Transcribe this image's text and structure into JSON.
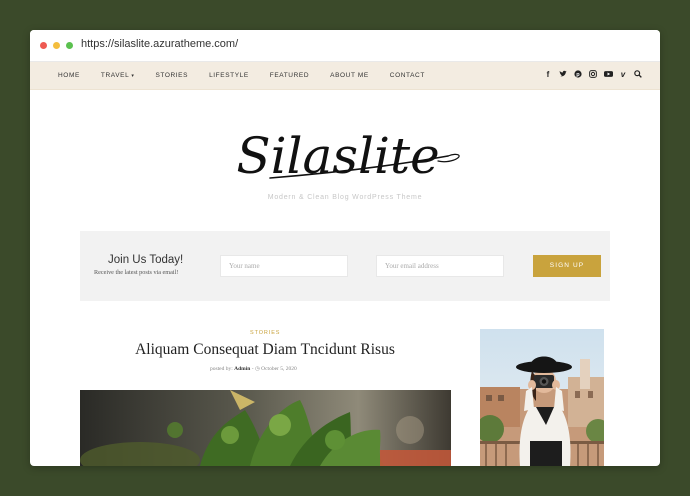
{
  "browser": {
    "url": "https://silaslite.azuratheme.com/"
  },
  "nav": {
    "items": [
      {
        "label": "HOME"
      },
      {
        "label": "TRAVEL",
        "has_dropdown": true
      },
      {
        "label": "STORIES"
      },
      {
        "label": "LIFESTYLE"
      },
      {
        "label": "FEATURED"
      },
      {
        "label": "ABOUT ME"
      },
      {
        "label": "CONTACT"
      }
    ],
    "social_icons": [
      "facebook-icon",
      "twitter-icon",
      "pinterest-icon",
      "instagram-icon",
      "youtube-icon",
      "vimeo-icon",
      "search-icon"
    ]
  },
  "header": {
    "logo_text": "Silaslite",
    "tagline": "Modern & Clean Blog WordPress Theme"
  },
  "subscribe": {
    "title": "Join Us Today!",
    "subtitle": "Receive the latest posts via email!",
    "name_placeholder": "Your name",
    "email_placeholder": "Your email address",
    "button_label": "SIGN UP"
  },
  "post": {
    "category": "STORIES",
    "title": "Aliquam Consequat Diam Tncidunt Risus",
    "posted_by_label": "posted by:",
    "author": "Admin",
    "separator": "-",
    "date": "October 5, 2020"
  },
  "colors": {
    "accent": "#c9a33d",
    "nav_bg": "#f3ece1",
    "page_bg": "#3b4a2a"
  }
}
